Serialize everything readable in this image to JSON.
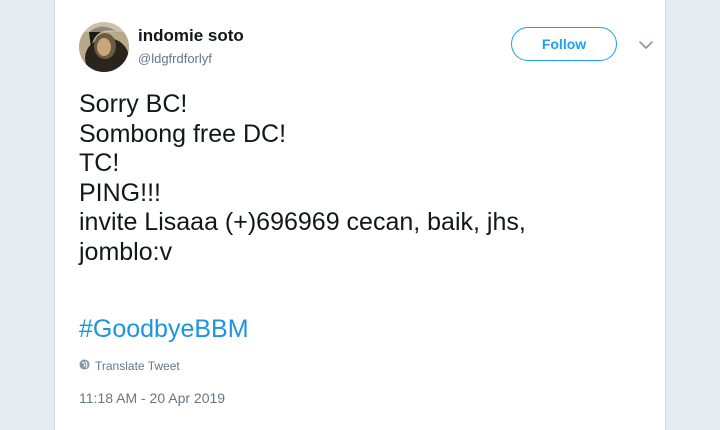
{
  "author": {
    "display_name": "indomie soto",
    "handle": "@ldgfrdforlyf"
  },
  "follow_button": {
    "label": "Follow"
  },
  "tweet": {
    "lines": [
      "Sorry BC!",
      "Sombong free DC!",
      "TC!",
      "PING!!!",
      "invite Lisaaa (+)696969 cecan, baik, jhs,",
      "jomblo:v"
    ],
    "hashtag": "#GoodbyeBBM",
    "translate_label": "Translate Tweet",
    "timestamp": "11:18 AM - 20 Apr 2019"
  },
  "colors": {
    "accent": "#1da1f2",
    "hashtag": "#1b95e0",
    "text": "#14171a",
    "muted": "#657786"
  },
  "icons": {
    "caret": "chevron-down-icon",
    "translate": "globe-icon"
  }
}
